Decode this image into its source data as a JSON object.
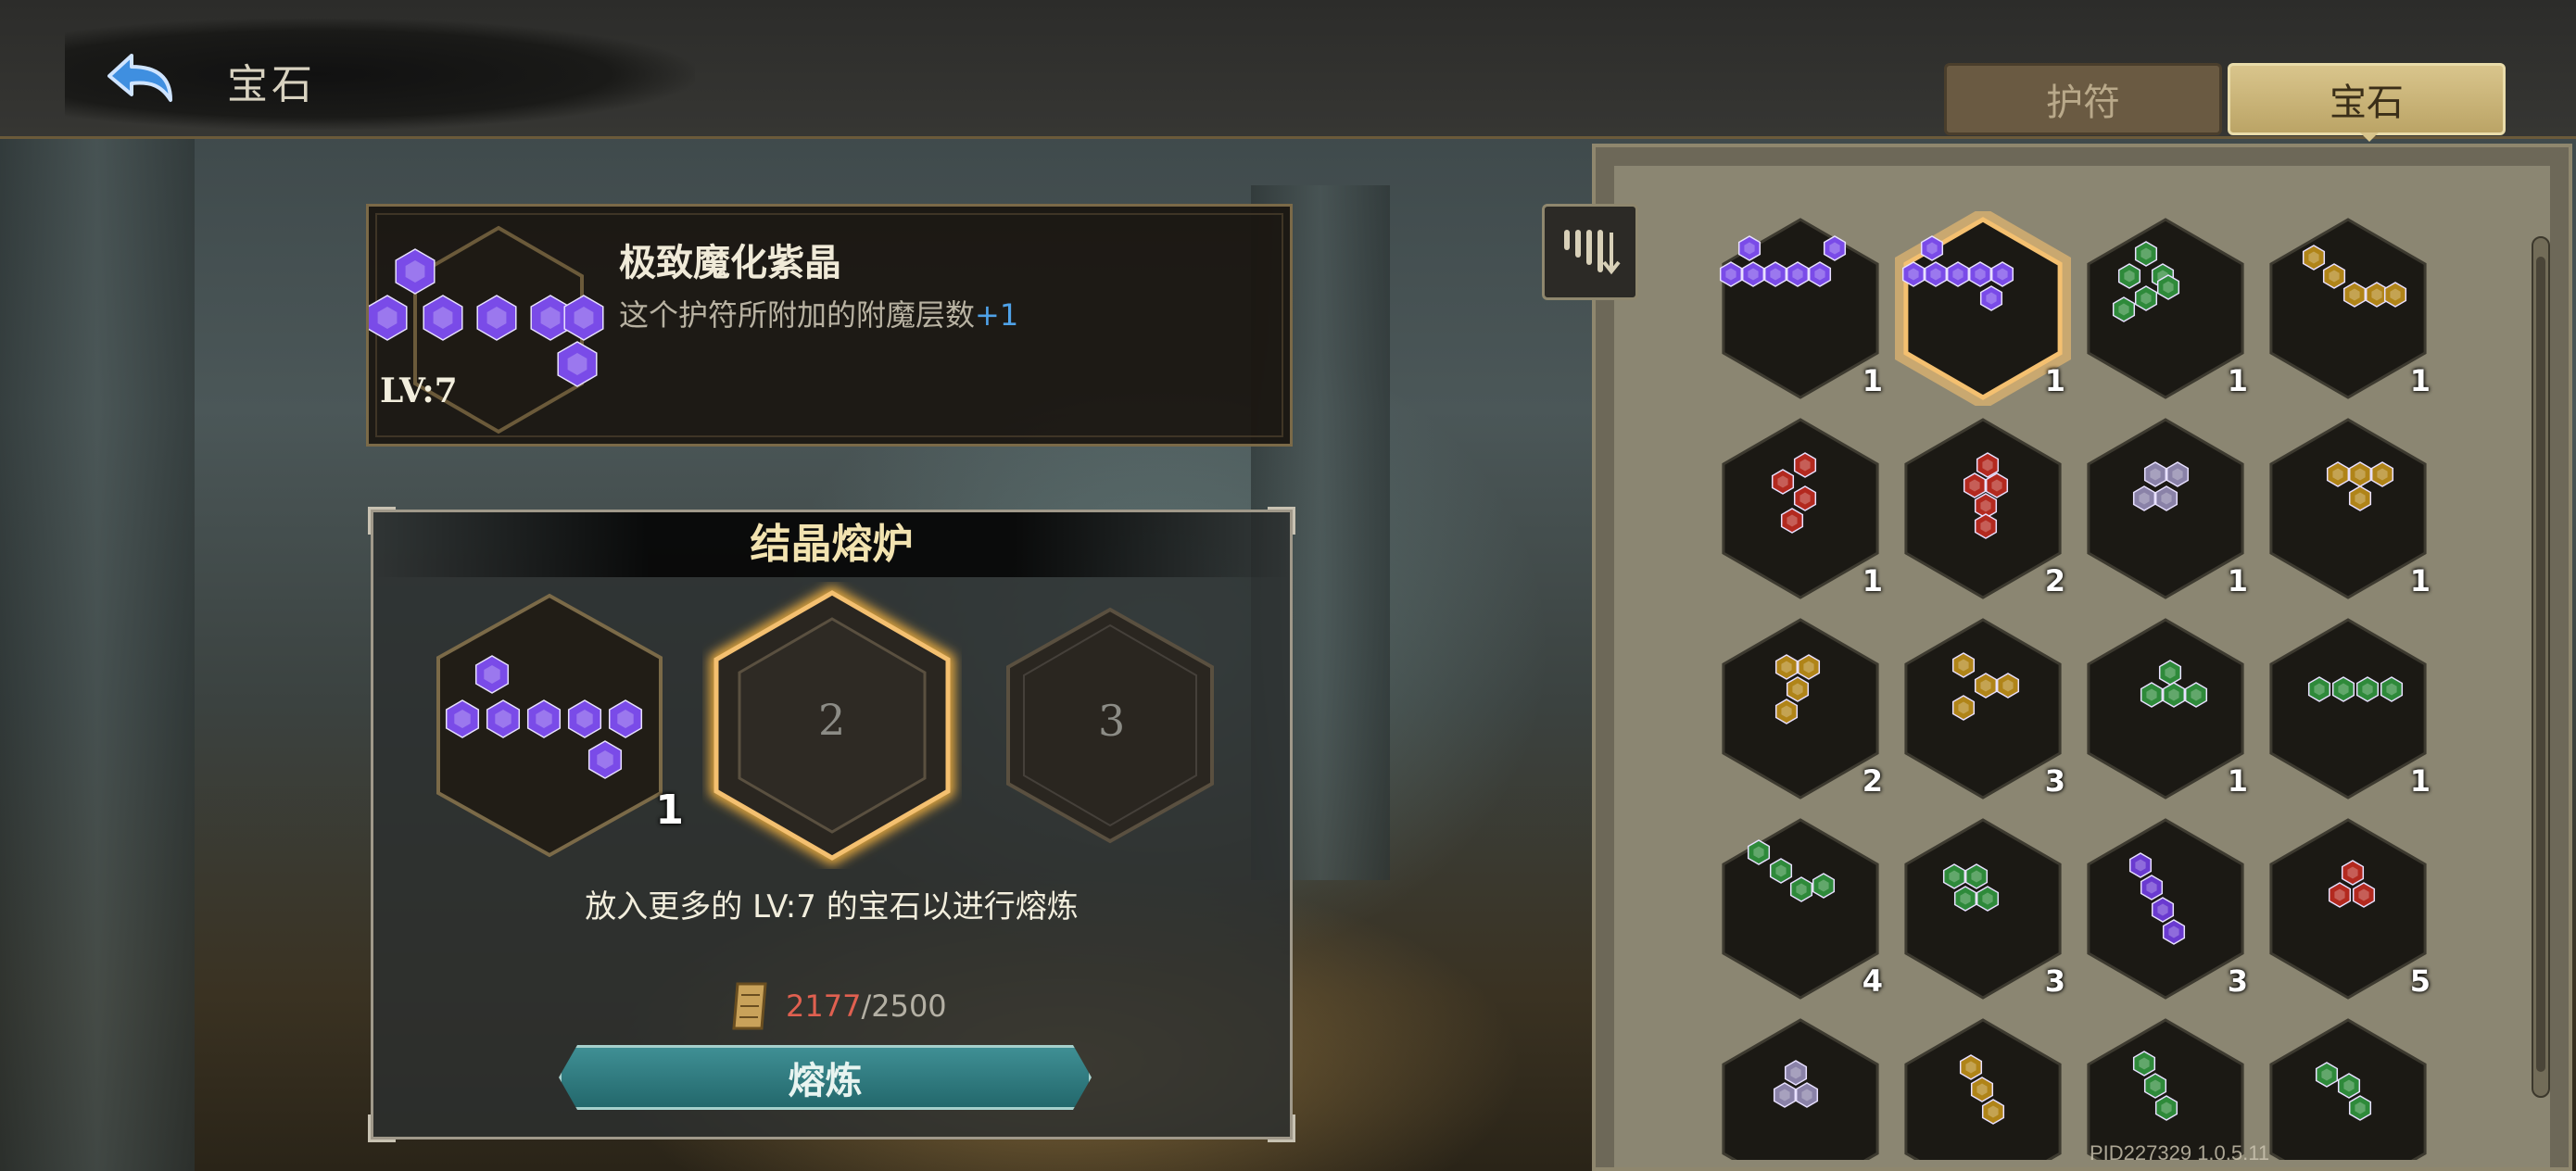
{
  "header": {
    "title": "宝石"
  },
  "tabs": [
    {
      "label": "护符",
      "active": false
    },
    {
      "label": "宝石",
      "active": true
    }
  ],
  "selected_gem": {
    "name": "极致魔化紫晶",
    "desc_prefix": "这个护符所附加的附魔层数",
    "desc_bonus": "+1",
    "level": "LV:7",
    "color": "#7a4be8"
  },
  "furnace": {
    "title": "结晶熔炉",
    "slots": [
      {
        "label": "",
        "count": "1",
        "filled": true,
        "color": "#7a4be8"
      },
      {
        "label": "2",
        "count": "",
        "filled": false
      },
      {
        "label": "3",
        "count": "",
        "filled": false
      }
    ],
    "hint": "放入更多的 LV:7 的宝石以进行熔炼",
    "cost_current": "2177",
    "cost_max": "/2500",
    "button": "熔炼"
  },
  "inventory": [
    {
      "count": "1",
      "color": "#7a4be8",
      "selected": false
    },
    {
      "count": "1",
      "color": "#7a4be8",
      "selected": true
    },
    {
      "count": "1",
      "color": "#2e8a3a",
      "selected": false
    },
    {
      "count": "1",
      "color": "#b08418",
      "selected": false
    },
    {
      "count": "1",
      "color": "#b3291f",
      "selected": false
    },
    {
      "count": "2",
      "color": "#b3291f",
      "selected": false
    },
    {
      "count": "1",
      "color": "#8a82a8",
      "selected": false
    },
    {
      "count": "1",
      "color": "#b08418",
      "selected": false
    },
    {
      "count": "2",
      "color": "#b08418",
      "selected": false
    },
    {
      "count": "3",
      "color": "#b08418",
      "selected": false
    },
    {
      "count": "1",
      "color": "#2e8a3a",
      "selected": false
    },
    {
      "count": "1",
      "color": "#2e8a3a",
      "selected": false
    },
    {
      "count": "4",
      "color": "#2e8a3a",
      "selected": false
    },
    {
      "count": "3",
      "color": "#2e8a3a",
      "selected": false
    },
    {
      "count": "3",
      "color": "#6a3ad0",
      "selected": false
    },
    {
      "count": "5",
      "color": "#b3291f",
      "selected": false
    },
    {
      "count": "",
      "color": "#8a82a8",
      "selected": false
    },
    {
      "count": "",
      "color": "#b08418",
      "selected": false
    },
    {
      "count": "",
      "color": "#2e8a3a",
      "selected": false
    },
    {
      "count": "",
      "color": "#2e8a3a",
      "selected": false
    }
  ],
  "pid": "PID227329 1.0.5.11"
}
